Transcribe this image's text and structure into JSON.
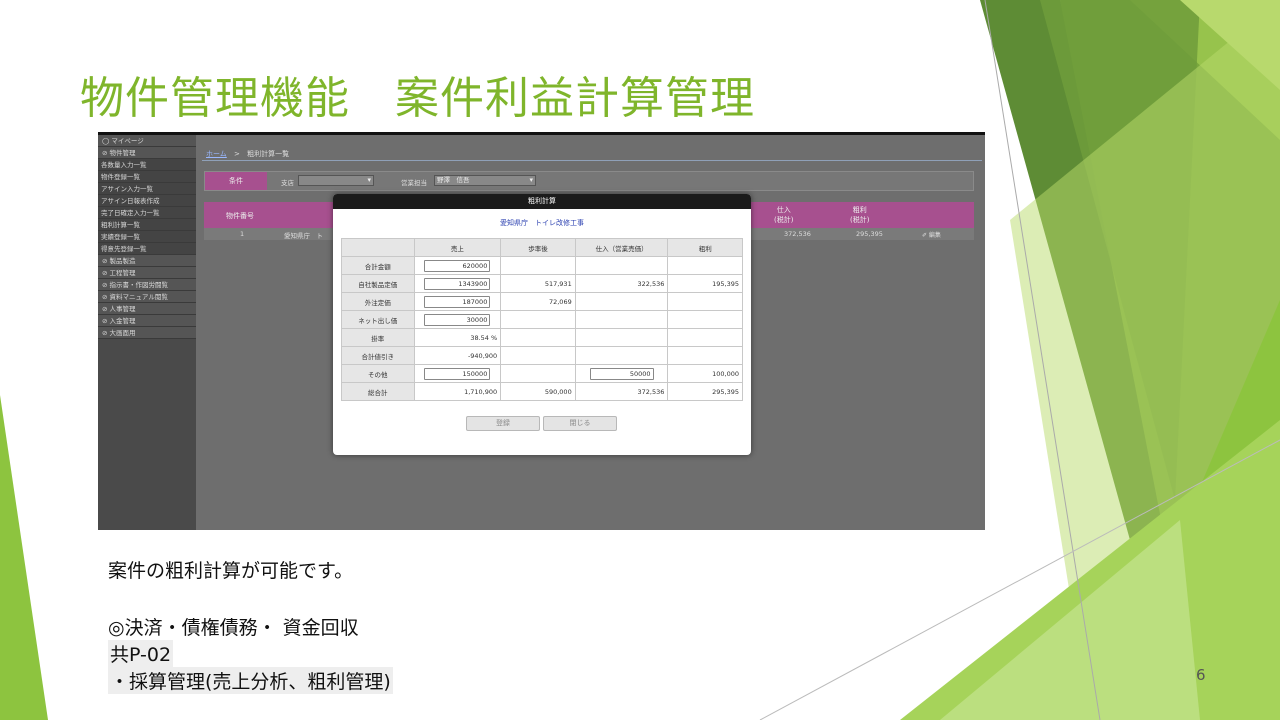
{
  "slide": {
    "title": "物件管理機能　案件利益計算管理",
    "page_number": "6",
    "body_line1": "案件の粗利計算が可能です。",
    "body_line2": "◎決済・債権債務・ 資金回収",
    "body_line3": "共P-02",
    "body_line4": "・採算管理(売上分析、粗利管理)",
    "accent_color": "#7fb52b"
  },
  "sidebar": {
    "items": [
      {
        "label": "◯ マイページ",
        "kind": "head"
      },
      {
        "label": "⊘ 物件管理",
        "kind": "head"
      },
      {
        "label": "各数量入力一覧",
        "kind": "sub"
      },
      {
        "label": "物件登録一覧",
        "kind": "sub"
      },
      {
        "label": "アサイン入力一覧",
        "kind": "sub"
      },
      {
        "label": "アサイン日報表作成",
        "kind": "sub"
      },
      {
        "label": "完了日確定入力一覧",
        "kind": "sub"
      },
      {
        "label": "粗利計算一覧",
        "kind": "sub"
      },
      {
        "label": "実績登録一覧",
        "kind": "sub"
      },
      {
        "label": "得意先登録一覧",
        "kind": "sub"
      },
      {
        "label": "⊘ 製品製造",
        "kind": "head"
      },
      {
        "label": "⊘ 工程管理",
        "kind": "head"
      },
      {
        "label": "⊘ 指示書・作図労闘覧",
        "kind": "head"
      },
      {
        "label": "⊘ 資料マニュアル閲覧",
        "kind": "head"
      },
      {
        "label": "⊘ 人事管理",
        "kind": "head"
      },
      {
        "label": "⊘ 入金管理",
        "kind": "head"
      },
      {
        "label": "⊘ 大画面用",
        "kind": "head"
      }
    ]
  },
  "breadcrumb": {
    "home": "ホーム",
    "sep": ">",
    "current": "粗利計算一覧"
  },
  "filter": {
    "cond_label": "条件",
    "branch_label": "支店",
    "branch_value": "",
    "sales_label": "営業担当",
    "sales_value": "野澤　信吾"
  },
  "list": {
    "headers": {
      "no": "物件番号",
      "purchase": "仕入\n(税計)",
      "profit": "粗利\n(税計)"
    },
    "row": {
      "no": "1",
      "name": "愛知県庁　ト",
      "purchase": "372,536",
      "profit": "295,395",
      "edit": "✐ 編集"
    }
  },
  "modal": {
    "title": "粗利計算",
    "subtitle": "愛知県庁　トイレ改修工事",
    "columns": [
      "",
      "売上",
      "歩率後",
      "仕入（営業売価）",
      "粗利"
    ],
    "rows": [
      {
        "label": "合計金額",
        "sales": "620000",
        "sales_input": true,
        "after": "",
        "purchase": "",
        "purchase_input": false,
        "profit": ""
      },
      {
        "label": "自社製品定価",
        "sales": "1343900",
        "sales_input": true,
        "after": "517,931",
        "purchase": "322,536",
        "purchase_input": false,
        "profit": "195,395"
      },
      {
        "label": "外注定価",
        "sales": "187000",
        "sales_input": true,
        "after": "72,069",
        "purchase": "",
        "purchase_input": false,
        "profit": ""
      },
      {
        "label": "ネット出し価",
        "sales": "30000",
        "sales_input": true,
        "after": "",
        "purchase": "",
        "purchase_input": false,
        "profit": ""
      },
      {
        "label": "掛率",
        "sales": "38.54 %",
        "sales_input": false,
        "after": "",
        "purchase": "",
        "purchase_input": false,
        "profit": ""
      },
      {
        "label": "合計値引き",
        "sales": "-940,900",
        "sales_input": false,
        "after": "",
        "purchase": "",
        "purchase_input": false,
        "profit": ""
      },
      {
        "label": "その他",
        "sales": "150000",
        "sales_input": true,
        "after": "",
        "purchase": "50000",
        "purchase_input": true,
        "profit": "100,000"
      },
      {
        "label": "総合計",
        "sales": "1,710,900",
        "sales_input": false,
        "after": "590,000",
        "purchase": "372,536",
        "purchase_input": false,
        "profit": "295,395"
      }
    ],
    "register_label": "登録",
    "close_label": "閉じる"
  }
}
